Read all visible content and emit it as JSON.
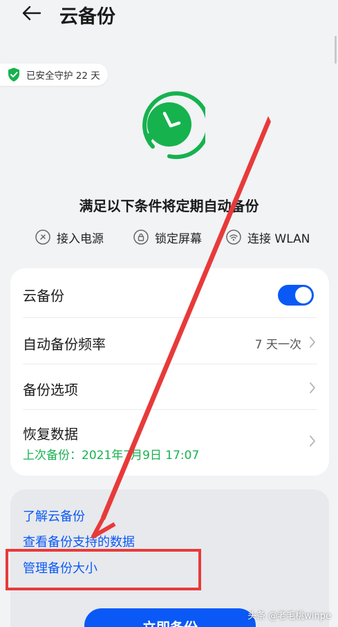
{
  "header": {
    "title": "云备份"
  },
  "badge": {
    "text": "已安全守护 22 天"
  },
  "conditions": {
    "title": "满足以下条件将定期自动备份",
    "items": [
      {
        "label": "接入电源",
        "icon": "charging-plug-icon"
      },
      {
        "label": "锁定屏幕",
        "icon": "lock-icon"
      },
      {
        "label": "连接 WLAN",
        "icon": "wifi-icon"
      }
    ]
  },
  "settings": {
    "cloud_backup": {
      "label": "云备份",
      "enabled": true
    },
    "frequency": {
      "label": "自动备份频率",
      "value": "7 天一次"
    },
    "options": {
      "label": "备份选项"
    },
    "restore": {
      "label": "恢复数据",
      "last_backup": "上次备份：2021年7月9日 17:07"
    }
  },
  "links": {
    "learn": "了解云备份",
    "supported_data": "查看备份支持的数据",
    "manage_size": "管理备份大小"
  },
  "primary_button": {
    "label": "立即备份"
  },
  "watermark": "头条 @老毛桃winpe",
  "colors": {
    "accent": "#0a59f7",
    "green": "#16b24e",
    "annotation": "#e83a3a",
    "background": "#f1f3f5"
  }
}
